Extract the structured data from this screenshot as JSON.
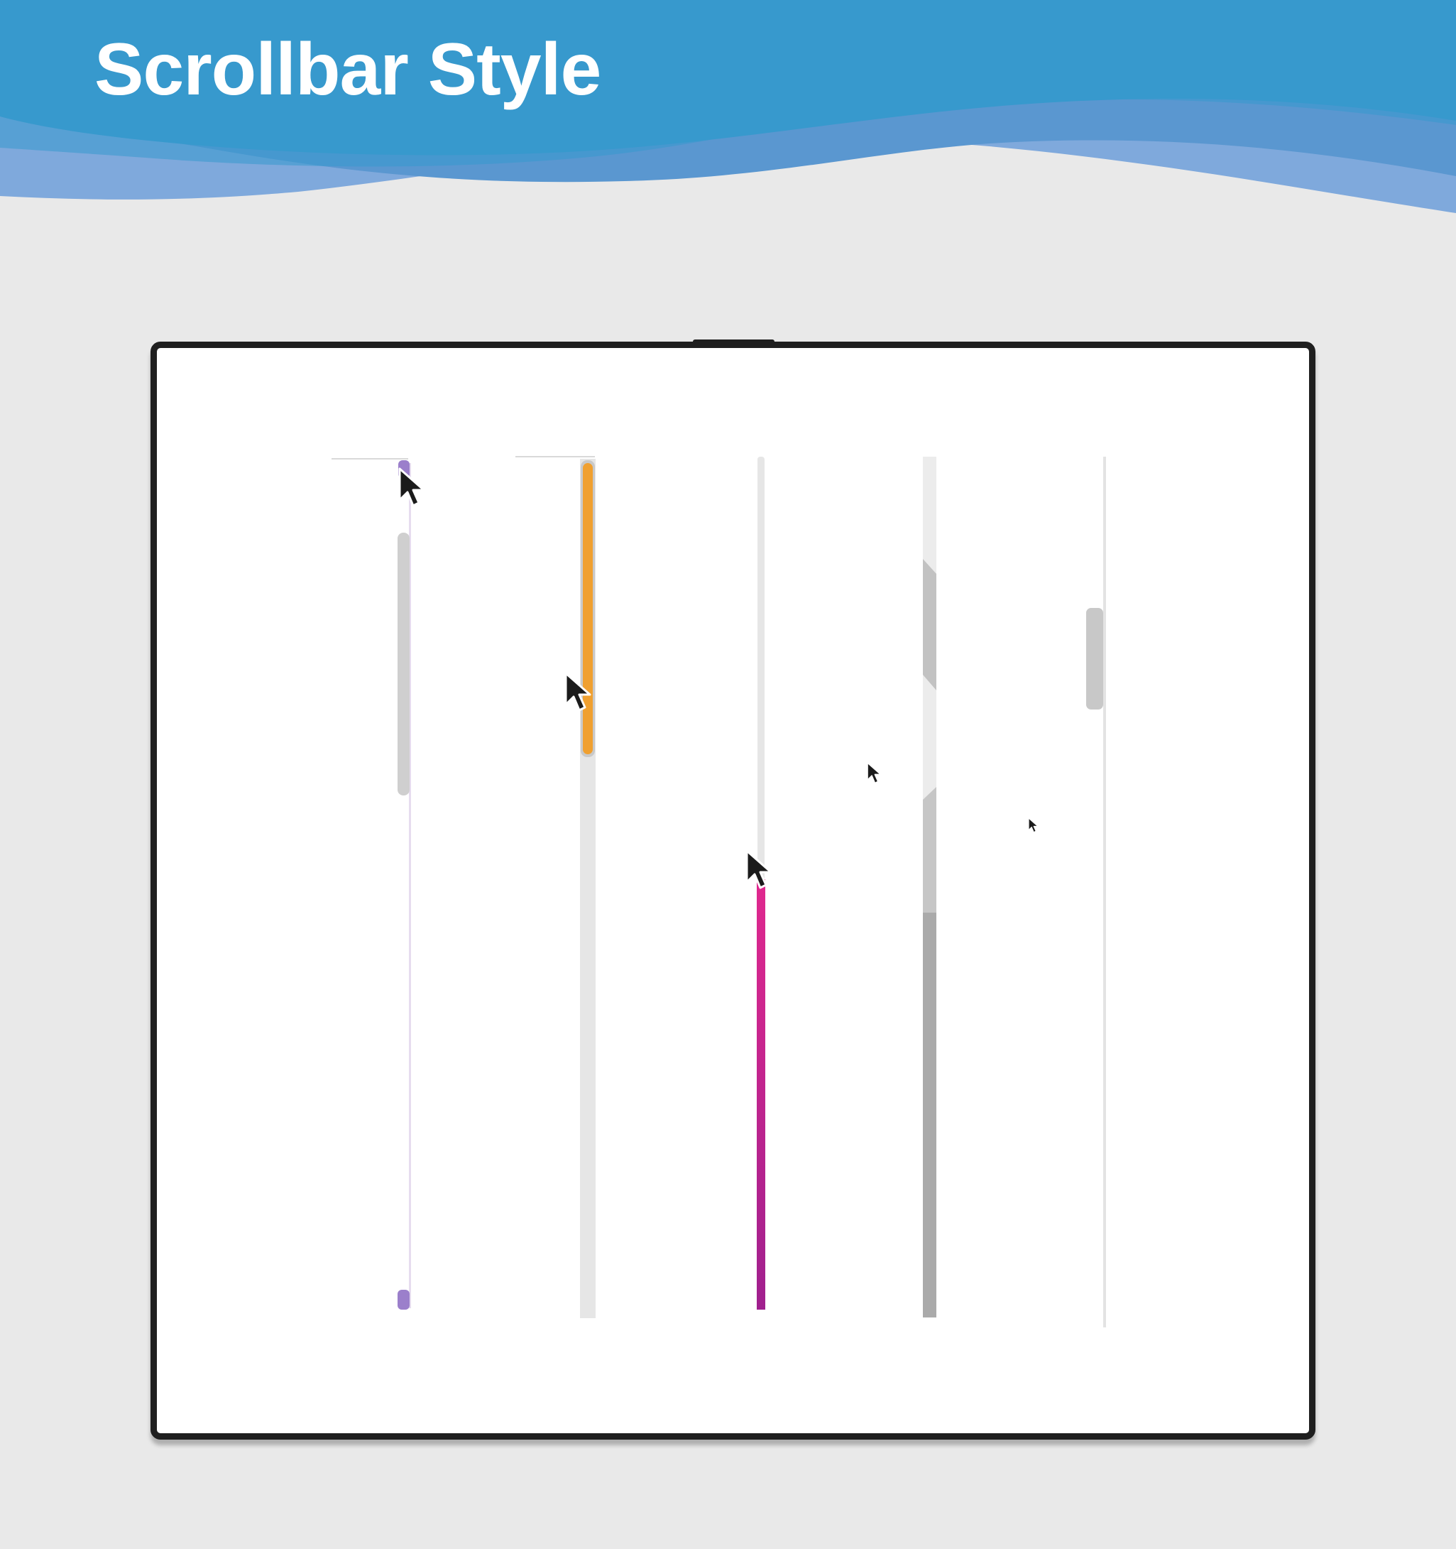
{
  "page": {
    "title": "Scrollbar Style"
  },
  "colors": {
    "header_blue": "#3799cd",
    "wave_light": "#7fa9dc",
    "wave_mid": "#5a97d0",
    "page_background": "#e9e9e9",
    "window_border": "#1f1f1f",
    "window_background": "#ffffff"
  },
  "scrollbars": [
    {
      "id": "style-1",
      "thumb_color": "#cfcfcf",
      "track_color": "#e6dcef",
      "button_color": "#9b7fcb",
      "has_arrow_buttons": true
    },
    {
      "id": "style-2",
      "thumb_color": "#f0a030",
      "track_color": "#e6e6e6",
      "has_arrow_buttons": false
    },
    {
      "id": "style-3",
      "thumb_color": "#e0288e",
      "thumb_gradient_end": "#a0208e",
      "track_color": "#e6e6e6",
      "has_arrow_buttons": false
    },
    {
      "id": "style-4",
      "thumb_color": "#c2c2c2",
      "track_color": "#ececec",
      "filled_color": "#aaaaaa",
      "has_arrow_buttons": false
    },
    {
      "id": "style-5",
      "thumb_color": "#c8c8c8",
      "track_color": "#e3e3e3",
      "has_arrow_buttons": false
    }
  ]
}
